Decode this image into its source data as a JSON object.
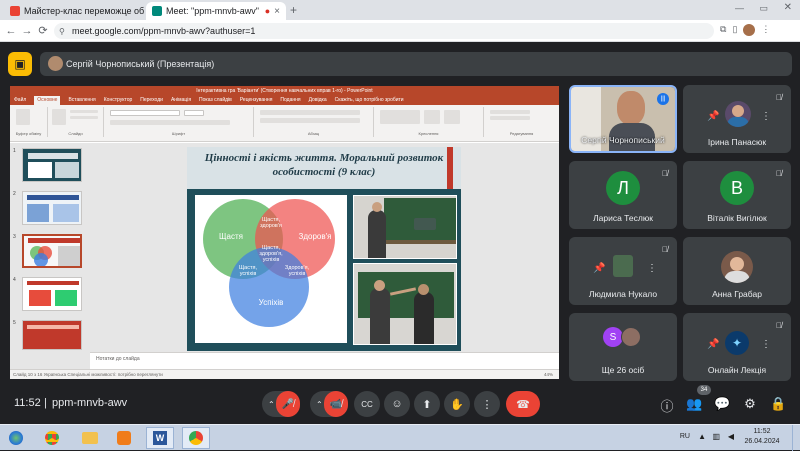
{
  "browser": {
    "tabs": [
      {
        "title": "Майстер-клас переможце обла",
        "icon_color": "#ea4335",
        "close": "×"
      },
      {
        "title": "Meet: \"ppm-mnvb-awv\"",
        "icon_color": "#00897b",
        "close": "×",
        "recording": "●"
      }
    ],
    "new_tab": "+",
    "url": "meet.google.com/ppm-mnvb-awv?authuser=1",
    "nav": {
      "back": "←",
      "forward": "→",
      "reload": "⟳"
    }
  },
  "meet": {
    "presenter_label": "Сергій Чорнописький (Презентація)",
    "side_panel_icon": "▣",
    "time": "11:52",
    "separator": "|",
    "meeting_code": "ppm-mnvb-awv",
    "participant_badge": "34",
    "controls": {
      "mic": "🎤̸",
      "cam": "📹̸",
      "captions": "CC",
      "emoji": "☺",
      "present": "⬆",
      "raise_hand": "✋",
      "more": "⋮",
      "end_call": "☎"
    },
    "right_icons": {
      "info": "ⓘ",
      "people": "👥",
      "chat": "💬",
      "activities": "⚙",
      "lock": "🔒"
    }
  },
  "participants": [
    {
      "name": "Сергій Чорнописький",
      "type": "video",
      "accent": "#8ab4f8"
    },
    {
      "name": "Ірина Панасюк",
      "type": "photo",
      "pinned": true
    },
    {
      "name": "Лариса Теслюк",
      "initial": "Л",
      "color": "#1e8e3e"
    },
    {
      "name": "Віталік Вигілюк",
      "initial": "В",
      "color": "#1e8e3e"
    },
    {
      "name": "Людмила Нукало",
      "type": "photo",
      "pinned": true
    },
    {
      "name": "Анна Грабар",
      "type": "photo"
    },
    {
      "name": "Ще 26 осіб",
      "initial": "S",
      "color": "#a142f4"
    },
    {
      "name": "Онлайн Лекція",
      "type": "photo",
      "pinned": true
    }
  ],
  "ppt": {
    "title_bar": "Інтерактивна гра 'Варіанти' (Створення навчальних вправ 1-го) - PowerPoint",
    "tabs": [
      "Файл",
      "Основне",
      "Вставлення",
      "Конструктор",
      "Переходи",
      "Анімація",
      "Показ слайдів",
      "Рецензування",
      "Подання",
      "Довідка",
      "Скажіть, що потрібно зробити"
    ],
    "active_tab": "Основне",
    "groups": [
      "Буфер обміну",
      "Слайди",
      "Шрифт",
      "Абзац",
      "Креслення",
      "Редагування"
    ],
    "slide_numbers": [
      "1",
      "2",
      "3",
      "4",
      "5"
    ],
    "slide": {
      "title": "Цінності і якість життя. Моральний розвиток особистості (9 клас)",
      "venn": {
        "happiness": "Щастя",
        "health": "Здоров'я",
        "success": "Успіхів",
        "happy_health": "Щастя, здоров'я",
        "happy_success": "Щастя, успіхів",
        "health_success": "Здоров'я, успіхів",
        "all_three": "Щастя, здоров'я, успіхів"
      }
    },
    "notes_placeholder": "Нотатки до слайда",
    "status": "Слайд 10 з 16   Українська   Спеціальні можливості: потрібно переглянути",
    "zoom": "44%"
  },
  "taskbar": {
    "apps": [
      "start",
      "chrome",
      "explorer",
      "media",
      "word",
      "chrome"
    ],
    "lang": "RU",
    "time": "11:52",
    "date": "26.04.2024"
  }
}
